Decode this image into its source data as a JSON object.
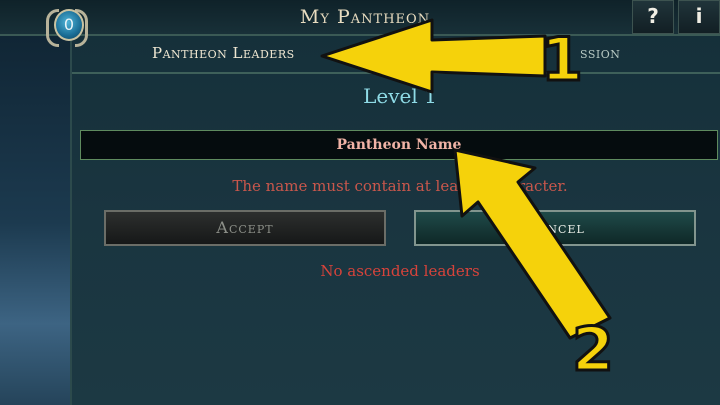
{
  "header": {
    "title": "My Pantheon",
    "counter_value": "0",
    "help_label": "?",
    "info_label": "i"
  },
  "tabs": [
    {
      "label": "Pantheon Leaders"
    },
    {
      "label": "ssion"
    }
  ],
  "level_label": "Level 1",
  "name_input": {
    "value": "Pantheon Name"
  },
  "validation_error": "The name must contain at least 1 character.",
  "buttons": {
    "accept_label": "Accept",
    "cancel_label": "Cancel"
  },
  "empty_state": "No ascended leaders",
  "annotations": {
    "arrow_1_number": "1",
    "arrow_2_number": "2",
    "arrow_color": "#f5d20b",
    "arrow_outline_color": "#111111"
  },
  "colors": {
    "error_red": "#c9574c",
    "level_cyan": "#8fdbe6",
    "field_text": "#f1b3a6"
  }
}
